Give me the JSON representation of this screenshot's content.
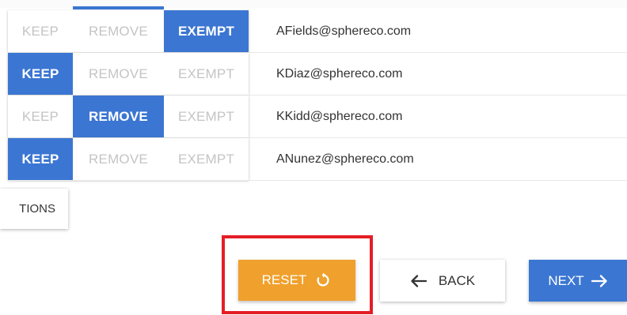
{
  "options": [
    "KEEP",
    "REMOVE",
    "EXEMPT"
  ],
  "rows": [
    {
      "email": "AFields@sphereco.com",
      "selected": "EXEMPT"
    },
    {
      "email": "KDiaz@sphereco.com",
      "selected": "KEEP"
    },
    {
      "email": "KKidd@sphereco.com",
      "selected": "REMOVE"
    },
    {
      "email": "ANunez@sphereco.com",
      "selected": "KEEP"
    }
  ],
  "options_button": {
    "label": "TIONS"
  },
  "footer": {
    "reset_label": "RESET",
    "back_label": "BACK",
    "next_label": "NEXT"
  },
  "colors": {
    "active_blue": "#3b76d2",
    "reset_orange": "#f0a02c",
    "highlight_red": "#e41e26"
  }
}
